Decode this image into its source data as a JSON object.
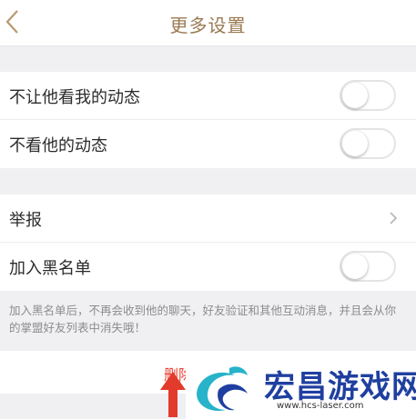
{
  "header": {
    "title": "更多设置"
  },
  "privacy": {
    "items": [
      {
        "label": "不让他看我的动态",
        "enabled": false
      },
      {
        "label": "不看他的动态",
        "enabled": false
      }
    ]
  },
  "actions": {
    "report_label": "举报",
    "blacklist_label": "加入黑名单",
    "blacklist_enabled": false,
    "blacklist_note": "加入黑名单后，不再会收到他的聊天，好友验证和其他互动消息，并且会从你的掌盟好友列表中消失哦！"
  },
  "footer": {
    "delete_label": "删除"
  },
  "watermark": {
    "name": "宏昌游戏网",
    "url": "www.hcs-laser.com"
  },
  "colors": {
    "accent": "#9a7a52",
    "danger": "#e94335",
    "watermark": "#1f3fa0",
    "background": "#f0f0f3"
  }
}
